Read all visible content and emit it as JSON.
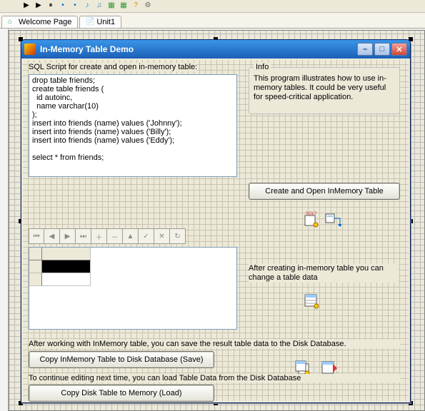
{
  "toolbar_icons": [
    "play",
    "play2",
    "pause",
    "dot",
    "dot",
    "note",
    "note2",
    "db",
    "db2",
    "help",
    "sep",
    "gear"
  ],
  "tabs": [
    {
      "label": "Welcome Page",
      "icon": "home"
    },
    {
      "label": "Unit1",
      "icon": "doc"
    }
  ],
  "form": {
    "title": "In-Memory Table Demo",
    "window_buttons": {
      "min": "–",
      "max": "□",
      "close": "✕"
    },
    "sql_label": "SQL Script for create and open in-memory table:",
    "sql_text": "drop table friends;\ncreate table friends (\n  id autoinc,\n  name varchar(10)\n);\ninsert into friends (name) values ('Johnny');\ninsert into friends (name) values ('Billy');\ninsert into friends (name) values ('Eddy');\n\nselect * from friends;",
    "info": {
      "title": "Info",
      "text": "This program illustrates how to use in-memory tables. It could be very useful for speed-critical application."
    },
    "create_button": "Create and Open InMemory Table",
    "after_create_label": "After creating in-memory table you can change a table data",
    "after_work_label": "After working with InMemory table, you can save the result table data to the Disk Database.",
    "save_button": "Copy InMemory Table to Disk Database  (Save)",
    "continue_label": "To continue editing next time, you can load Table Data from the Disk Database",
    "load_button": "Copy Disk Table to Memory  (Load)",
    "navigator_glyphs": [
      "⏮",
      "◀",
      "▶",
      "⏭",
      "＋",
      "－",
      "▲",
      "✓",
      "✕",
      "↻"
    ]
  }
}
